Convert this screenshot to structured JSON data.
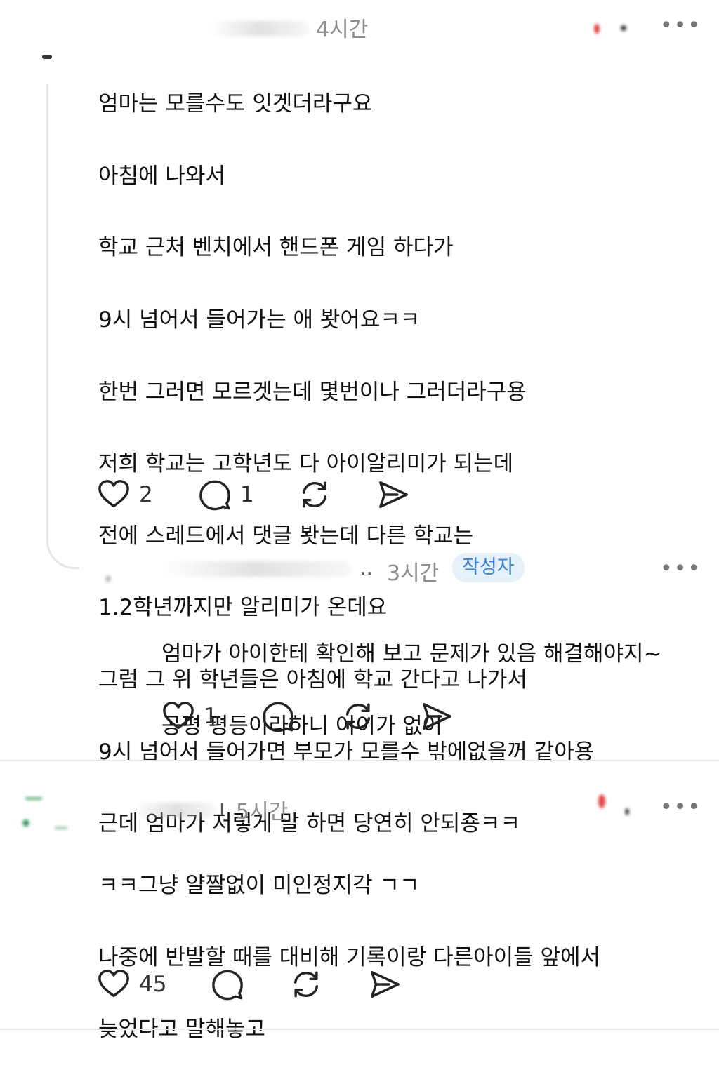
{
  "comment1": {
    "time": "4시간",
    "lines": [
      "엄마는 모를수도 잇겟더라구요",
      "아침에 나와서",
      "학교 근처 벤치에서 핸드폰 게임 하다가",
      "9시 넘어서 들어가는 애 봣어요ㅋㅋ",
      "한번 그러면 모르겟는데 몇번이나 그러더라구용",
      "저희 학교는 고학년도 다 아이알리미가 되는데",
      "전에 스레드에서 댓글 봣는데 다른 학교는",
      "1.2학년까지만 알리미가 온데요",
      "그럼 그 위 학년들은 아침에 학교 간다고 나가서",
      "9시 넘어서 들어가면 부모가 모를수 밖에없을꺼 같아용",
      "근데 엄마가 저렇게 말 하면 당연히 안되죵ㅋㅋ"
    ],
    "likes": "2",
    "replies": "1"
  },
  "reply1": {
    "name_fragment": "..",
    "time": "3시간",
    "badge": "작성자",
    "lines": [
      "엄마가 아이한테 확인해 보고 문제가 있음 해결해야지~",
      "공평 평등이라하니 어이가 없어"
    ],
    "likes": "1"
  },
  "comment2": {
    "name_fragment": "ı",
    "time": "5시간",
    "lines": [
      "ㅋㅋ그냥 얄짤없이 미인정지각 ㄱㄱ",
      "나중에 반발할 때를 대비해 기록이랑 다른아이들 앞에서",
      "늦었다고 말해놓고"
    ],
    "likes": "45"
  },
  "more_label": "•••",
  "icons": {
    "like": "heart-icon",
    "reply": "comment-bubble-icon",
    "repost": "repost-icon",
    "share": "send-icon",
    "more": "more-dots-icon"
  },
  "colors": {
    "text": "#111111",
    "meta": "#8e8e8e",
    "badge_bg": "#e6f0fb",
    "badge_text": "#3a82d4",
    "line": "#e6e6e6"
  }
}
